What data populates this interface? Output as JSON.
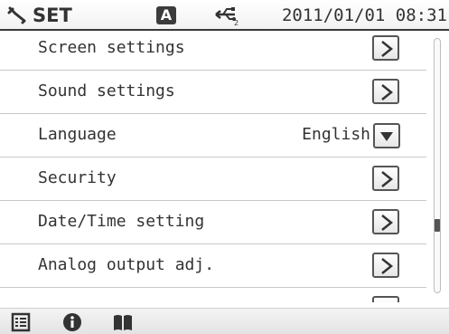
{
  "status_bar": {
    "title": "SET",
    "mode_badge": "A",
    "datetime": "2011/01/01 08:31",
    "icons": [
      "wrench-icon",
      "usb-icon"
    ]
  },
  "settings": {
    "items": [
      {
        "label": "Screen settings",
        "control": "arrow"
      },
      {
        "label": "Sound settings",
        "control": "arrow"
      },
      {
        "label": "Language",
        "value": "English",
        "control": "dropdown"
      },
      {
        "label": "Security",
        "control": "arrow"
      },
      {
        "label": "Date/Time setting",
        "control": "arrow"
      },
      {
        "label": "Analog output adj.",
        "control": "arrow"
      }
    ]
  },
  "bottom_bar": {
    "icons": [
      "list-icon",
      "info-icon",
      "book-icon"
    ]
  },
  "colors": {
    "text": "#333333",
    "border": "#555555",
    "divider": "#c8c8c8",
    "status_underline": "#3a3a3a"
  }
}
